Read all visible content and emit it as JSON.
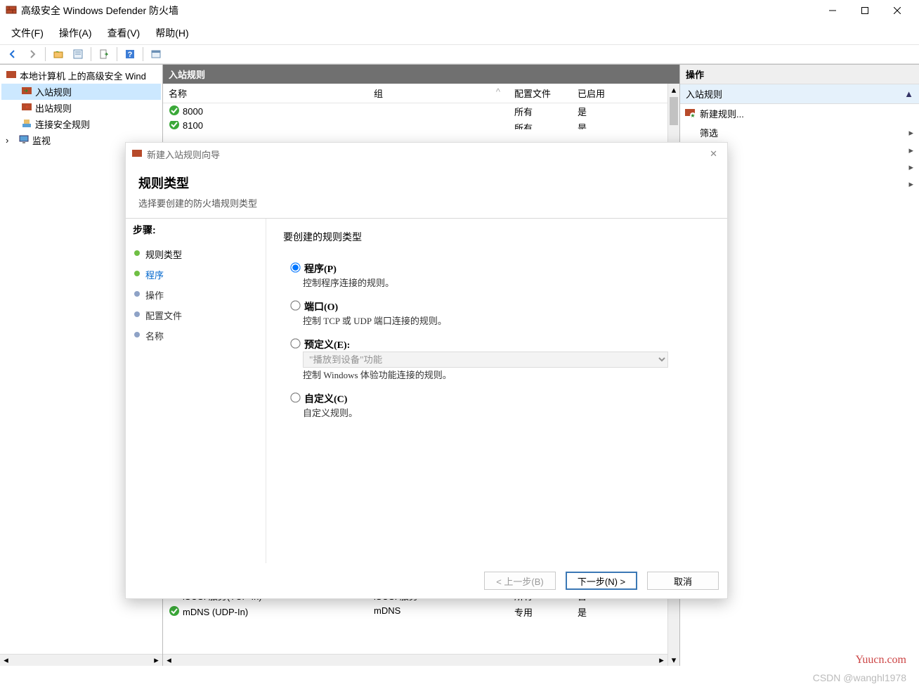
{
  "window": {
    "title": "高级安全 Windows Defender 防火墙"
  },
  "menu": [
    "文件(F)",
    "操作(A)",
    "查看(V)",
    "帮助(H)"
  ],
  "tree": {
    "root": "本地计算机 上的高级安全 Wind",
    "items": [
      "入站规则",
      "出站规则",
      "连接安全规则",
      "监视"
    ]
  },
  "center": {
    "header": "入站规则",
    "columns": {
      "name": "名称",
      "group": "组",
      "profile": "配置文件",
      "enabled": "已启用"
    },
    "rows": [
      {
        "name": "8000",
        "group": "",
        "profile": "所有",
        "enabled": "是",
        "green": true
      },
      {
        "name": "8100",
        "group": "",
        "profile": "所有",
        "enabled": "是",
        "green": true
      },
      {
        "name": "iSCSI 服务(TCP-In)",
        "group": "iSCSI 服务",
        "profile": "所有",
        "enabled": "否",
        "green": false
      },
      {
        "name": "mDNS (UDP-In)",
        "group": "mDNS",
        "profile": "专用",
        "enabled": "是",
        "green": true
      }
    ]
  },
  "right": {
    "header": "操作",
    "sub": "入站规则",
    "new_rule": "新建规则...",
    "filter": "筛选"
  },
  "wizard": {
    "title": "新建入站规则向导",
    "header": "规则类型",
    "sub": "选择要创建的防火墙规则类型",
    "steps_label": "步骤:",
    "steps": [
      "规则类型",
      "程序",
      "操作",
      "配置文件",
      "名称"
    ],
    "question": "要创建的规则类型",
    "options": {
      "program": {
        "label": "程序(P)",
        "desc": "控制程序连接的规则。"
      },
      "port": {
        "label": "端口(O)",
        "desc": "控制 TCP 或 UDP 端口连接的规则。"
      },
      "predef": {
        "label": "预定义(E):",
        "desc": "控制 Windows 体验功能连接的规则。",
        "select": "\"播放到设备\"功能"
      },
      "custom": {
        "label": "自定义(C)",
        "desc": "自定义规则。"
      }
    },
    "buttons": {
      "back": "< 上一步(B)",
      "next": "下一步(N) >",
      "cancel": "取消"
    }
  },
  "watermark1": "Yuucn.com",
  "watermark2": "CSDN @wanghl1978"
}
